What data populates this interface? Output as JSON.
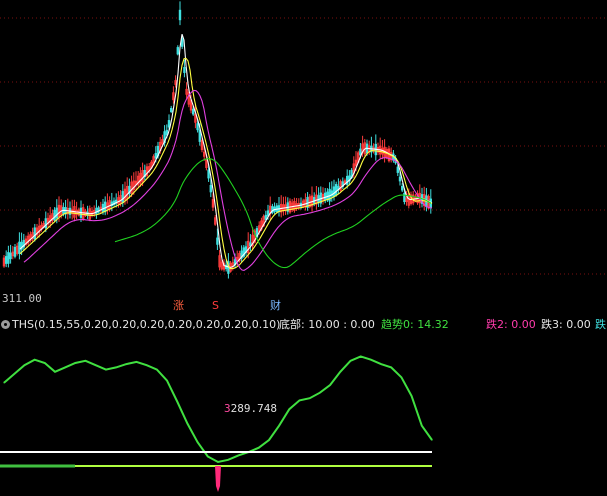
{
  "colors": {
    "background": "#000000",
    "grid": "#7a1010",
    "candle_up": "#ff3c3c",
    "candle_down": "#40e0e0",
    "ma_short": "#ffffff",
    "ma_mid": "#ffff40",
    "ma_long": "#e040e0",
    "ma_trend": "#20d020",
    "indicator_line": "#40e040",
    "marker": "#ff2a7a"
  },
  "main": {
    "price_label": "311.00",
    "events": [
      {
        "label": "涨",
        "color": "#ff6040"
      },
      {
        "label": "S",
        "color": "#ff3c3c"
      },
      {
        "label": "财",
        "color": "#7ab8ff"
      }
    ]
  },
  "indicator": {
    "name": "THS",
    "params": "(0.15,55,0.20,0.20,0.20,0.20,0.20,0.20,0.10)",
    "items": [
      {
        "label": "底部: 10.00 : 0.00",
        "color": "#e6e6e6"
      },
      {
        "label": "趋势0: 14.32",
        "color": "#40e040"
      },
      {
        "label": "跌2: 0.00",
        "color": "#ff3cac"
      },
      {
        "label": "跌3: 0.00",
        "color": "#e6e6e6"
      },
      {
        "label": "跌",
        "color": "#40e0e0"
      }
    ],
    "value_label_prefix": "3",
    "value_label": "289.748"
  },
  "chart_data": {
    "type": "line",
    "series": [
      {
        "values": [
          72,
          80,
          88,
          93,
          90,
          82,
          86,
          90,
          92,
          88,
          84,
          86,
          89,
          91,
          88,
          84,
          74,
          55,
          35,
          18,
          5,
          0,
          2,
          6,
          9,
          13,
          20,
          33,
          48,
          56,
          58,
          63,
          70,
          82,
          92,
          96,
          93,
          89,
          86,
          77,
          60,
          33,
          20
        ]
      }
    ],
    "markers": [
      {
        "index": 21,
        "value": 0
      }
    ]
  }
}
